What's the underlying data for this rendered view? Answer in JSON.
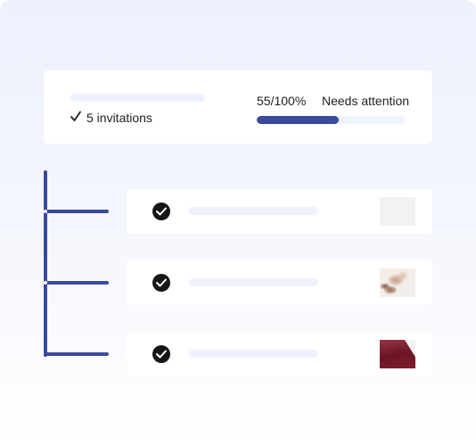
{
  "summary": {
    "invitations_label": "5 invitations",
    "progress_text": "55/100%",
    "progress_fraction": 0.55,
    "status_text": "Needs attention"
  },
  "items": [
    {
      "thumbnail": "blank-thumbnail"
    },
    {
      "thumbnail": "hair-photo-thumbnail"
    },
    {
      "thumbnail": "fabric-photo-thumbnail"
    }
  ],
  "colors": {
    "accent": "#3a4a9c",
    "placeholder": "#eef2fc",
    "check": "#161616"
  },
  "icons": {
    "summary_check": "checkmark-icon",
    "item_check": "check-circle-icon"
  }
}
